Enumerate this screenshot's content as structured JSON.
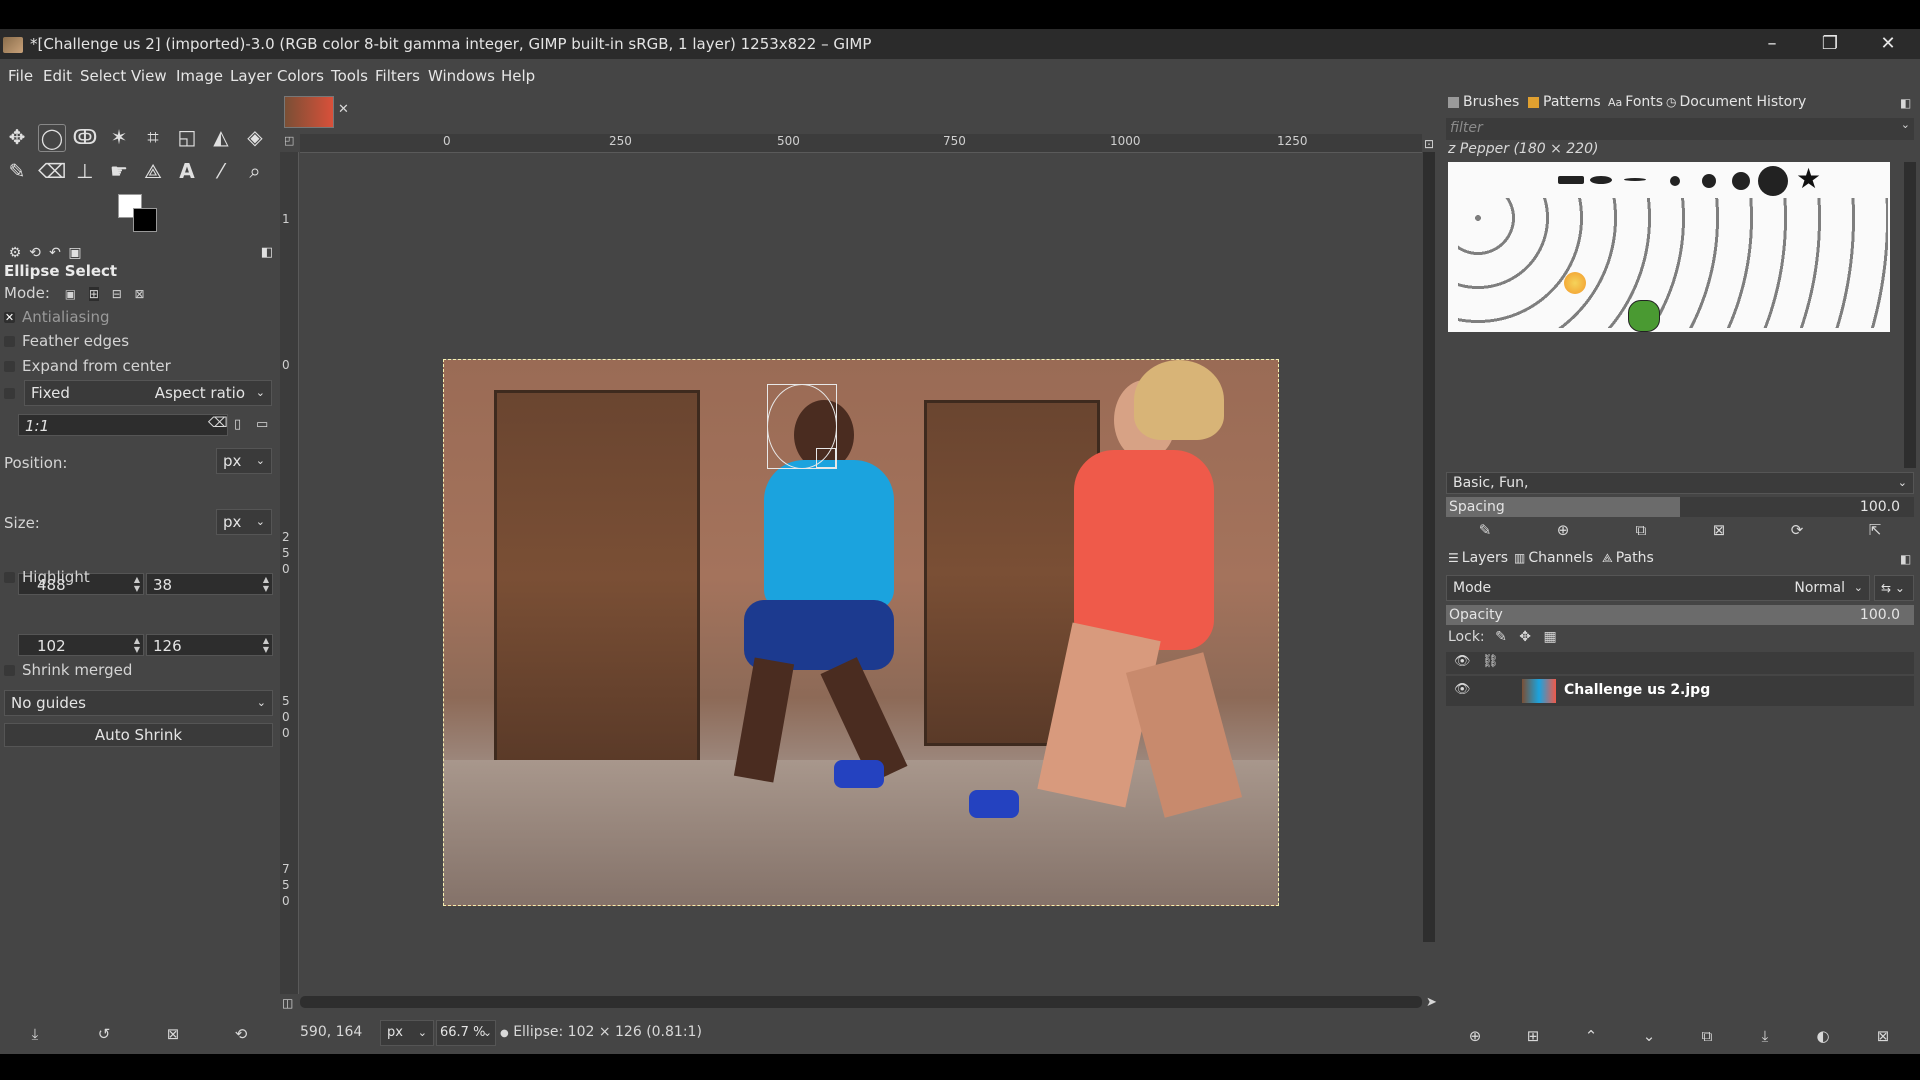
{
  "window": {
    "title": "*[Challenge us 2] (imported)-3.0 (RGB color 8-bit gamma integer, GIMP built-in sRGB, 1 layer) 1253x822 – GIMP",
    "minimize": "–",
    "maximize": "❐",
    "close": "✕"
  },
  "menubar": [
    "File",
    "Edit",
    "Select",
    "View",
    "Image",
    "Layer",
    "Colors",
    "Tools",
    "Filters",
    "Windows",
    "Help"
  ],
  "tool_options": {
    "title": "Ellipse Select",
    "mode_label": "Mode:",
    "antialiasing": "Antialiasing",
    "feather_edges": "Feather edges",
    "expand_from_center": "Expand from center",
    "fixed_label": "Fixed",
    "fixed_value": "Aspect ratio",
    "ratio_value": "1:1",
    "position_label": "Position:",
    "position_unit": "px",
    "position_x": "488",
    "position_y": "38",
    "size_label": "Size:",
    "size_unit": "px",
    "size_w": "102",
    "size_h": "126",
    "highlight": "Highlight",
    "guides": "No guides",
    "auto_shrink": "Auto Shrink",
    "shrink_merged": "Shrink merged"
  },
  "ruler": {
    "h_ticks": [
      "0",
      "250",
      "500",
      "750",
      "1000",
      "1250"
    ],
    "v_ticks": [
      "1",
      "0",
      "2",
      "5",
      "0",
      "5",
      "0",
      "0",
      "7",
      "5",
      "0"
    ]
  },
  "status": {
    "coords": "590, 164",
    "unit": "px",
    "zoom": "66.7 %",
    "message": "Ellipse: 102 × 126  (0.81:1)"
  },
  "brushes_panel": {
    "tabs": [
      "Brushes",
      "Patterns",
      "Fonts",
      "Document History"
    ],
    "filter_placeholder": "filter",
    "brush_name": "z Pepper (180 × 220)",
    "tags": "Basic, Fun,",
    "spacing_label": "Spacing",
    "spacing_value": "100.0",
    "spacing_fraction": 0.5
  },
  "layers_panel": {
    "tabs": [
      "Layers",
      "Channels",
      "Paths"
    ],
    "mode_label": "Mode",
    "mode_value": "Normal",
    "opacity_label": "Opacity",
    "opacity_value": "100.0",
    "lock_label": "Lock:",
    "layer_name": "Challenge us 2.jpg"
  },
  "colors": {
    "accent": "#2b2b2b",
    "panel": "#454545",
    "selection": "#f5f0b0"
  }
}
